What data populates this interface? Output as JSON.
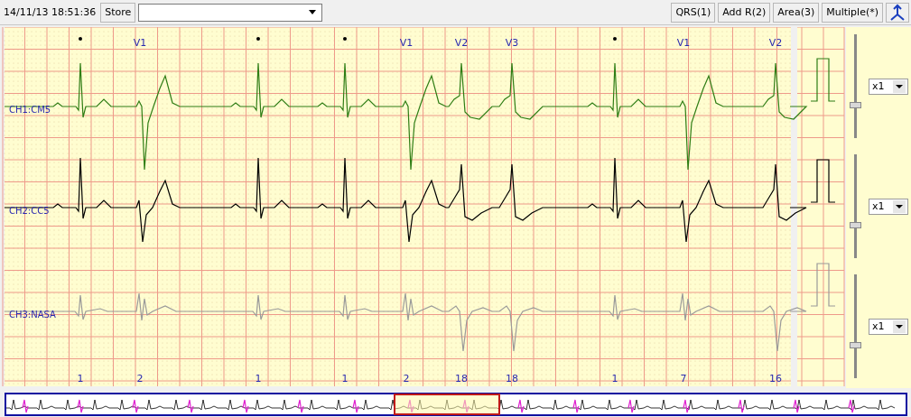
{
  "toolbar": {
    "timestamp": "14/11/13 18:51:36",
    "store_button": "Store",
    "buttons": [
      "QRS(1)",
      "Add R(2)",
      "Area(3)",
      "Multiple(*)"
    ]
  },
  "channels": [
    {
      "name": "CH1:CM5",
      "color": "#2e7d14",
      "gain": "x1",
      "level": 0.31
    },
    {
      "name": "CH2:CC5",
      "color": "#000000",
      "gain": "x1",
      "level": 0.31
    },
    {
      "name": "CH3:NASA",
      "color": "#9a9a9a",
      "gain": "x1",
      "level": 0.31
    }
  ],
  "beats": [
    {
      "kind": "normal",
      "label": "1"
    },
    {
      "kind": "ventricular",
      "top": "V1",
      "label": "2"
    },
    {
      "kind": "normal",
      "label": "1"
    },
    {
      "kind": "normal",
      "label": "1"
    },
    {
      "kind": "ventricular",
      "top": "V1",
      "label": "2"
    },
    {
      "kind": "aberrant",
      "top": "V2",
      "label": "18"
    },
    {
      "kind": "aberrant",
      "top": "V3",
      "label": "18"
    },
    {
      "kind": "normal",
      "label": "1"
    },
    {
      "kind": "ventricular",
      "top": "V1",
      "label": "7"
    },
    {
      "kind": "aberrant",
      "top": "V2",
      "label": "16"
    }
  ]
}
